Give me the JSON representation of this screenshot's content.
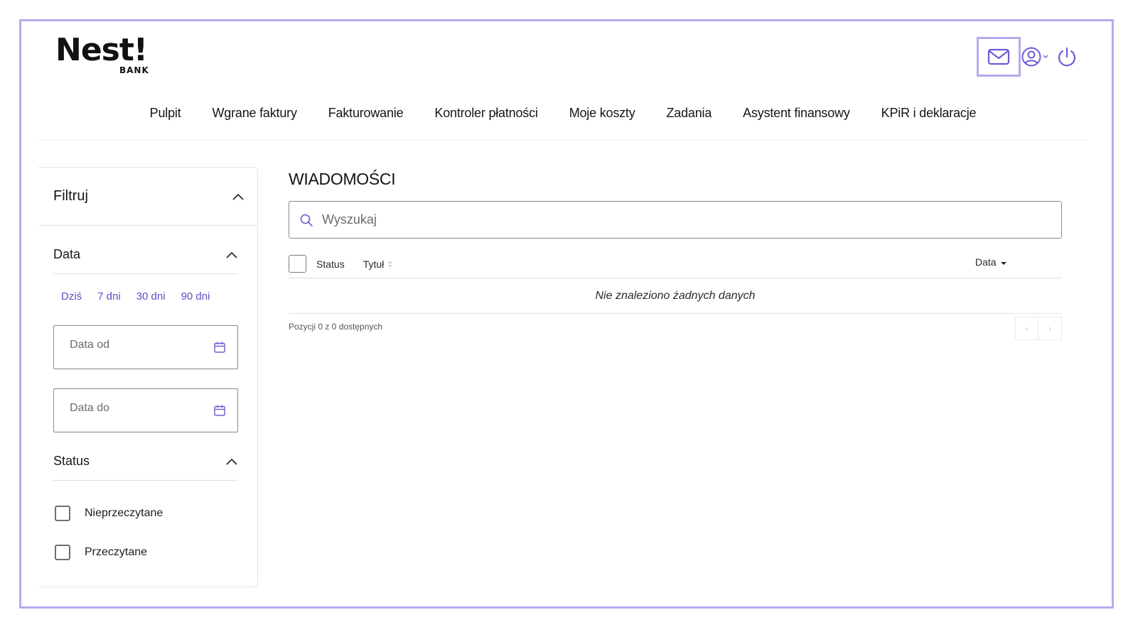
{
  "brand": {
    "name": "Nest!",
    "sub": "BANK"
  },
  "nav": {
    "items": [
      {
        "label": "Pulpit"
      },
      {
        "label": "Wgrane faktury"
      },
      {
        "label": "Fakturowanie"
      },
      {
        "label": "Kontroler płatności"
      },
      {
        "label": "Moje koszty"
      },
      {
        "label": "Zadania"
      },
      {
        "label": "Asystent finansowy"
      },
      {
        "label": "KPiR i deklaracje"
      }
    ]
  },
  "header": {
    "icons": [
      "mail-icon",
      "user-icon",
      "chevron-down-icon",
      "power-icon"
    ]
  },
  "sidebar": {
    "title": "Filtruj",
    "date_section": {
      "title": "Data",
      "quick": [
        "Dziś",
        "7 dni",
        "30 dni",
        "90 dni"
      ],
      "from_placeholder": "Data od",
      "to_placeholder": "Data do"
    },
    "status_section": {
      "title": "Status",
      "options": [
        "Nieprzeczytane",
        "Przeczytane"
      ]
    }
  },
  "main": {
    "title": "WIADOMOŚCI",
    "search_placeholder": "Wyszukaj",
    "columns": {
      "status": "Status",
      "title": "Tytuł",
      "date": "Data"
    },
    "empty_text": "Nie znaleziono żadnych danych",
    "page_info": "Pozycji 0 z 0 dostępnych",
    "pager": {
      "prev": "‹",
      "next": "›"
    }
  },
  "colors": {
    "accent": "#5a4fc6",
    "frame": "#b9a9f0",
    "icon": "#6b5bd6"
  }
}
